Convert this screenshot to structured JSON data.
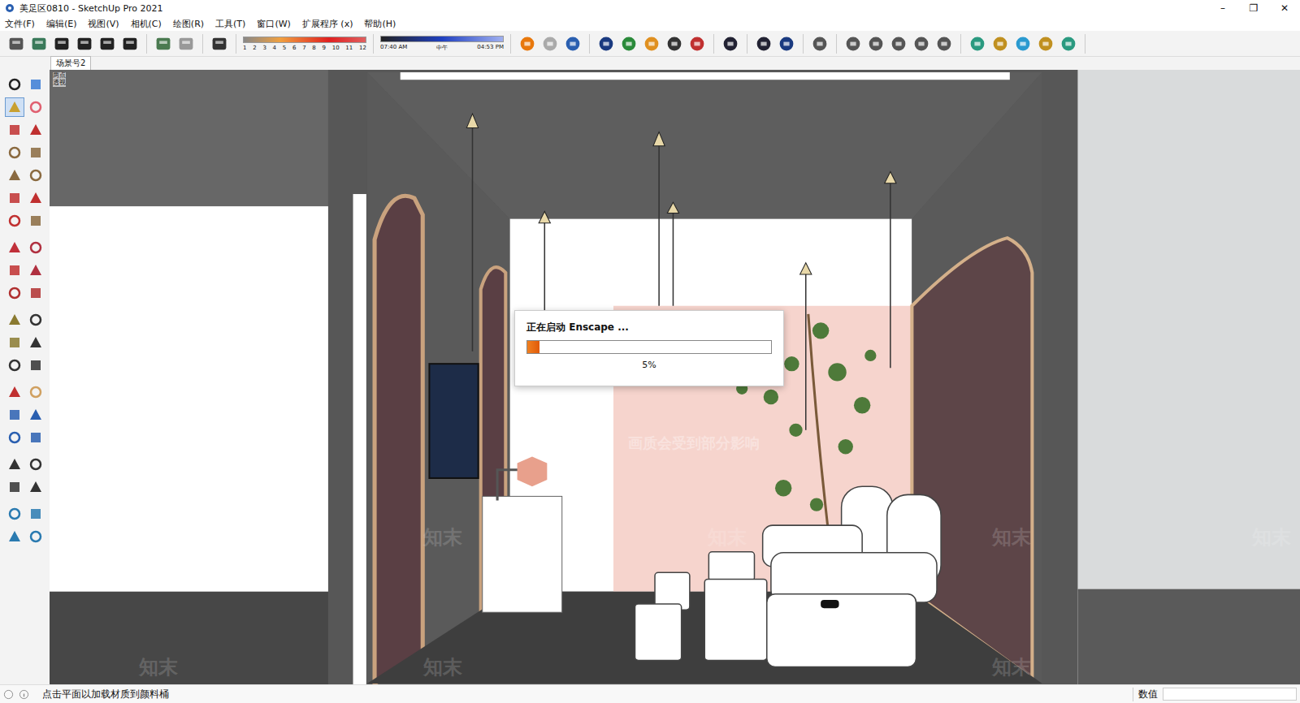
{
  "window": {
    "title": "美足区0810 - SketchUp Pro 2021",
    "controls": [
      "–",
      "❐",
      "✕"
    ]
  },
  "menu": [
    "文件(F)",
    "编辑(E)",
    "视图(V)",
    "相机(C)",
    "绘图(R)",
    "工具(T)",
    "窗口(W)",
    "扩展程序 (x)",
    "帮助(H)"
  ],
  "shadow": {
    "months": [
      "1",
      "2",
      "3",
      "4",
      "5",
      "6",
      "7",
      "8",
      "9",
      "10",
      "11",
      "12"
    ],
    "time_start": "07:40 AM",
    "time_mid": "中午",
    "time_end": "04:53 PM"
  },
  "scene_tabs": [
    {
      "label": "场景号2",
      "selected": true
    }
  ],
  "viewport": {
    "camera_label": "两点透视"
  },
  "dialog": {
    "title": "正在启动 Enscape ...",
    "level": 0.05,
    "reading": "5%"
  },
  "watermark": {
    "logo": "知末",
    "notice": "画质会受到部分影响"
  },
  "tools": [
    {
      "selected": false
    },
    {
      "selected": false
    },
    {
      "selected": true
    },
    {
      "selected": false
    },
    {
      "selected": false
    },
    {
      "selected": false
    },
    {
      "selected": false
    },
    {
      "selected": false
    },
    {
      "selected": false
    },
    {
      "selected": false
    },
    {
      "selected": false
    },
    {
      "selected": false
    },
    {
      "selected": false
    },
    {
      "selected": false
    },
    {
      "selected": false
    },
    {
      "selected": false
    },
    {
      "selected": false
    },
    {
      "selected": false
    },
    {
      "selected": false
    },
    {
      "selected": false
    },
    {
      "selected": false
    },
    {
      "selected": false
    },
    {
      "selected": false
    },
    {
      "selected": false
    },
    {
      "selected": false
    },
    {
      "selected": false
    },
    {
      "selected": false
    },
    {
      "selected": false
    },
    {
      "selected": false
    },
    {
      "selected": false
    },
    {
      "selected": false
    },
    {
      "selected": false
    },
    {
      "selected": false
    },
    {
      "selected": false
    },
    {
      "selected": false
    },
    {
      "selected": false
    },
    {
      "selected": false
    },
    {
      "selected": false
    },
    {
      "selected": false
    },
    {
      "selected": false
    }
  ],
  "status_bar": {
    "hint": "点击平面以加载材质到颜料桶",
    "measure_label": "数值",
    "measure_value": ""
  }
}
